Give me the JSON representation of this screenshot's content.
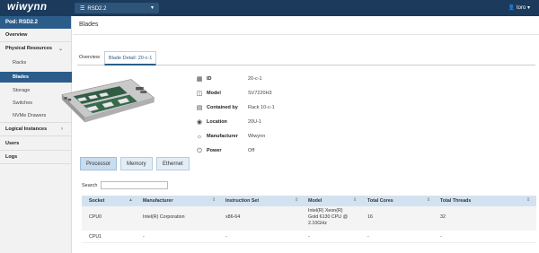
{
  "header": {
    "logo": "wiwynn",
    "pod_selector": "RSD2.2",
    "user": "toro"
  },
  "sidebar": {
    "pod_title": "Pod: RSD2.2",
    "items": [
      {
        "label": "Overview"
      },
      {
        "label": "Physical Resources"
      },
      {
        "label": "Racks"
      },
      {
        "label": "Blades"
      },
      {
        "label": "Storage"
      },
      {
        "label": "Switches"
      },
      {
        "label": "NVMe Drawers"
      },
      {
        "label": "Logical Instances"
      },
      {
        "label": "Users"
      },
      {
        "label": "Logs"
      }
    ]
  },
  "page": {
    "title": "Blades",
    "tabs": [
      {
        "label": "Overview"
      },
      {
        "label": "Blade Detail: 20-c-1"
      }
    ]
  },
  "blade": {
    "props": [
      {
        "icon": "id-icon",
        "label": "ID",
        "value": "20-c-1"
      },
      {
        "icon": "model-icon",
        "label": "Model",
        "value": "SV7220H3"
      },
      {
        "icon": "contained-icon",
        "label": "Contained by",
        "value": "Rack 10-c-1"
      },
      {
        "icon": "location-icon",
        "label": "Location",
        "value": "20U-1"
      },
      {
        "icon": "manufacturer-icon",
        "label": "Manufacturer",
        "value": "Wiwynn"
      },
      {
        "icon": "power-icon",
        "label": "Power",
        "value": "Off"
      }
    ]
  },
  "subtabs": [
    {
      "label": "Processor"
    },
    {
      "label": "Memory"
    },
    {
      "label": "Ethernet"
    }
  ],
  "search": {
    "label": "Search",
    "value": ""
  },
  "table": {
    "headers": [
      "Socket",
      "Manufacturer",
      "Instruction Set",
      "Model",
      "Total Cores",
      "Total Threads"
    ],
    "rows": [
      {
        "socket": "CPU0",
        "manufacturer": "Intel(R) Corporation",
        "instruction_set": "x86-64",
        "model_l1": "Intel(R) Xeon(R)",
        "model_l2": "Gold 6130 CPU @",
        "model_l3": "2.10GHz",
        "cores": "16",
        "threads": "32"
      },
      {
        "socket": "CPU1",
        "manufacturer": "-",
        "instruction_set": "-",
        "model_l1": "-",
        "model_l2": "",
        "model_l3": "",
        "cores": "-",
        "threads": "-"
      }
    ]
  }
}
